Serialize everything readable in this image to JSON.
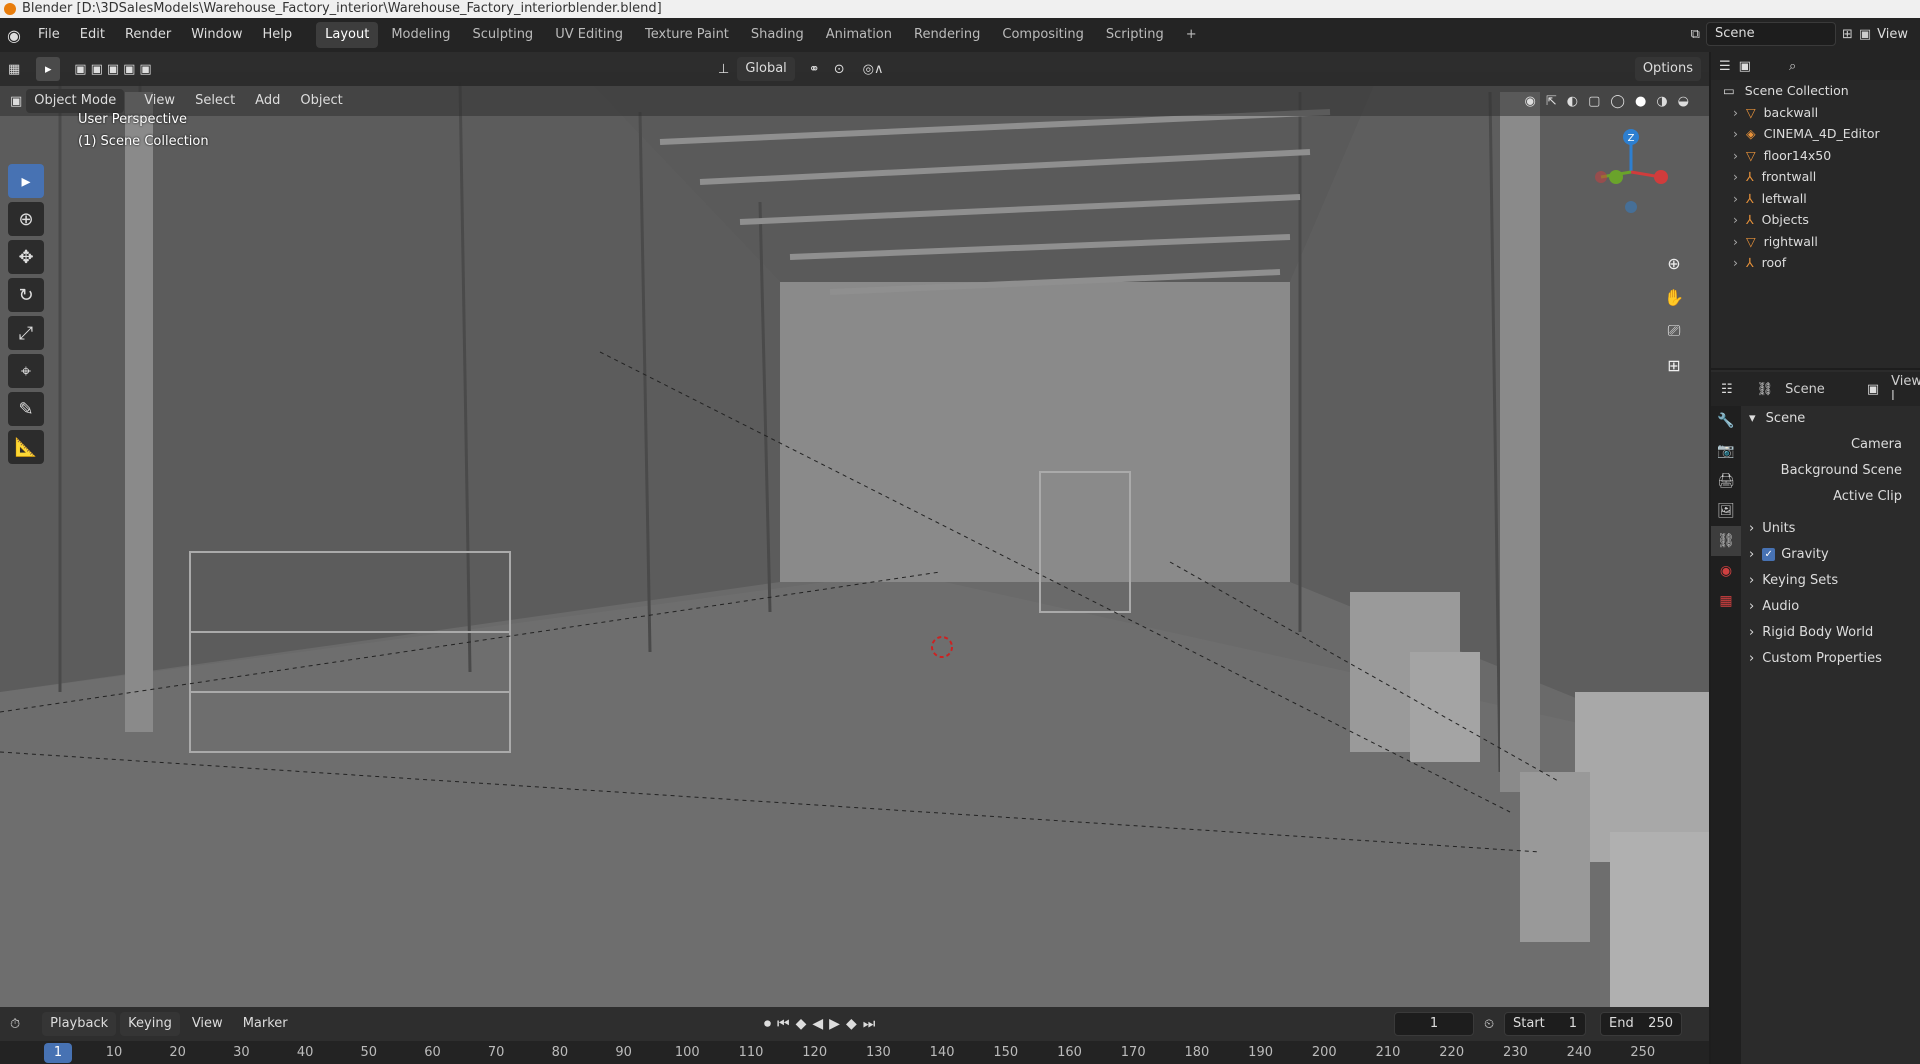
{
  "window": {
    "title": "Blender [D:\\3DSalesModels\\Warehouse_Factory_interior\\Warehouse_Factory_interiorblender.blend]"
  },
  "menu": [
    "File",
    "Edit",
    "Render",
    "Window",
    "Help"
  ],
  "workspaces": [
    "Layout",
    "Modeling",
    "Sculpting",
    "UV Editing",
    "Texture Paint",
    "Shading",
    "Animation",
    "Rendering",
    "Compositing",
    "Scripting",
    "+"
  ],
  "active_workspace": "Layout",
  "scene_selector": {
    "scene": "Scene",
    "view_layer": "View"
  },
  "viewport_header": {
    "mode": "Object Mode",
    "menus": [
      "View",
      "Select",
      "Add",
      "Object"
    ],
    "orientation": "Global",
    "options": "Options"
  },
  "overlay": {
    "perspective": "User Perspective",
    "collection": "(1) Scene Collection"
  },
  "gizmo": {
    "z": "Z"
  },
  "colors": {
    "accent": "#4772b3",
    "bg": "#636363",
    "panel": "#2b2b2b"
  },
  "outliner": {
    "root": "Scene Collection",
    "items": [
      {
        "name": "backwall",
        "icon": "triangle-mesh-icon"
      },
      {
        "name": "CINEMA_4D_Editor",
        "icon": "material-icon"
      },
      {
        "name": "floor14x50",
        "icon": "triangle-mesh-icon"
      },
      {
        "name": "frontwall",
        "icon": "empty-icon"
      },
      {
        "name": "leftwall",
        "icon": "empty-icon"
      },
      {
        "name": "Objects",
        "icon": "empty-icon"
      },
      {
        "name": "rightwall",
        "icon": "triangle-mesh-icon"
      },
      {
        "name": "roof",
        "icon": "empty-icon"
      }
    ]
  },
  "properties": {
    "header_scene": "Scene",
    "header_view": "View l",
    "section": "Scene",
    "fields": [
      "Camera",
      "Background Scene",
      "Active Clip"
    ],
    "panels": [
      {
        "label": "Units",
        "checkbox": false
      },
      {
        "label": "Gravity",
        "checkbox": true
      },
      {
        "label": "Keying Sets",
        "checkbox": false
      },
      {
        "label": "Audio",
        "checkbox": false
      },
      {
        "label": "Rigid Body World",
        "checkbox": false
      },
      {
        "label": "Custom Properties",
        "checkbox": false
      }
    ]
  },
  "timeline": {
    "menus": [
      "Playback",
      "Keying",
      "View",
      "Marker"
    ],
    "current_frame": "1",
    "start_label": "Start",
    "start": "1",
    "end_label": "End",
    "end": "250",
    "ruler_current": "1",
    "ruler": [
      "10",
      "20",
      "30",
      "40",
      "50",
      "60",
      "70",
      "80",
      "90",
      "100",
      "110",
      "120",
      "130",
      "140",
      "150",
      "160",
      "170",
      "180",
      "190",
      "200",
      "210",
      "220",
      "230",
      "240",
      "250"
    ]
  }
}
